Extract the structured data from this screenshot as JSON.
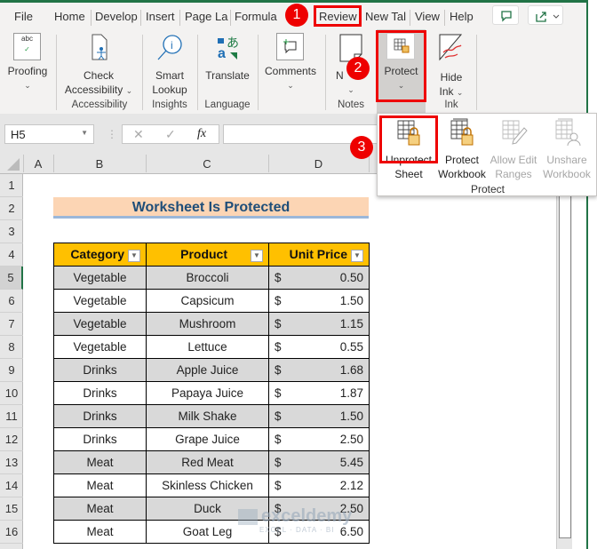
{
  "tabs": [
    "File",
    "Home",
    "Develop",
    "Insert",
    "Page La",
    "Formula",
    "Review",
    "New Tal",
    "View",
    "Help"
  ],
  "ribbon": {
    "proofing": "Proofing",
    "check_accessibility": [
      "Check",
      "Accessibility"
    ],
    "smart_lookup": [
      "Smart",
      "Lookup"
    ],
    "translate": "Translate",
    "comments": "Comments",
    "notes": "N",
    "protect": "Protect",
    "hide_ink": [
      "Hide",
      "Ink"
    ],
    "groups": {
      "accessibility": "Accessibility",
      "insights": "Insights",
      "language": "Language",
      "notes": "Notes",
      "ink": "Ink"
    }
  },
  "protect_menu": {
    "items": [
      {
        "l1": "Unprotect",
        "l2": "Sheet",
        "enabled": true
      },
      {
        "l1": "Protect",
        "l2": "Workbook",
        "enabled": true
      },
      {
        "l1": "Allow Edit",
        "l2": "Ranges",
        "enabled": false
      },
      {
        "l1": "Unshare",
        "l2": "Workbook",
        "enabled": false
      }
    ],
    "group_label": "Protect"
  },
  "formula_bar": {
    "name_box": "H5",
    "fx": "fx",
    "value": ""
  },
  "columns": [
    "A",
    "B",
    "C",
    "D"
  ],
  "rows": [
    "1",
    "2",
    "3",
    "4",
    "5",
    "6",
    "7",
    "8",
    "9",
    "10",
    "11",
    "12",
    "13",
    "14",
    "15",
    "16"
  ],
  "sheet": {
    "title": "Worksheet Is Protected",
    "headers": [
      "Category",
      "Product",
      "Unit Price"
    ],
    "currency": "$",
    "data": [
      [
        "Vegetable",
        "Broccoli",
        "0.50"
      ],
      [
        "Vegetable",
        "Capsicum",
        "1.50"
      ],
      [
        "Vegetable",
        "Mushroom",
        "1.15"
      ],
      [
        "Vegetable",
        "Lettuce",
        "0.55"
      ],
      [
        "Drinks",
        "Apple Juice",
        "1.68"
      ],
      [
        "Drinks",
        "Papaya Juice",
        "1.87"
      ],
      [
        "Drinks",
        "Milk Shake",
        "1.50"
      ],
      [
        "Drinks",
        "Grape Juice",
        "2.50"
      ],
      [
        "Meat",
        "Red Meat",
        "5.45"
      ],
      [
        "Meat",
        "Skinless Chicken",
        "2.12"
      ],
      [
        "Meat",
        "Duck",
        "2.50"
      ],
      [
        "Meat",
        "Goat Leg",
        "6.50"
      ]
    ]
  },
  "steps": [
    "1",
    "2",
    "3"
  ],
  "watermark": {
    "name": "exceldemy",
    "tagline": "EXCEL · DATA · BI"
  }
}
